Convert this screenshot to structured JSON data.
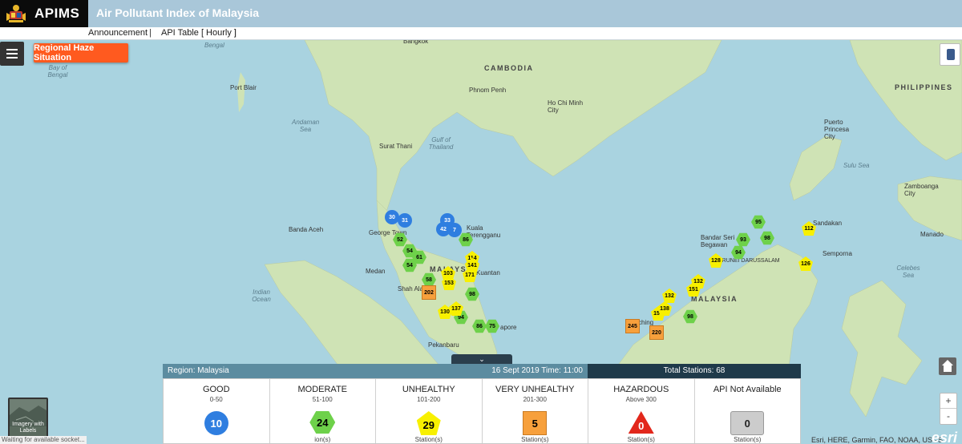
{
  "header": {
    "brand": "APIMS",
    "title": "Air Pollutant Index of Malaysia",
    "nav": [
      {
        "label": "Announcement"
      },
      {
        "label": "API Table [ Hourly ]"
      }
    ]
  },
  "controls": {
    "haze_button": "Regional Haze Situation",
    "basemap_label": "Imagery with Labels",
    "zoom_in": "+",
    "zoom_out": "-",
    "collapse_glyph": "⌄"
  },
  "status_text": "Waiting for available socket...",
  "attribution": "Esri, HERE, Garmin, FAO, NOAA, USGS",
  "esri_logo": "esri",
  "places": {
    "bangkok": "Bangkok",
    "cambodia": "CAMBODIA",
    "phnom_penh": "Phnom Penh",
    "ho_chi_minh": "Ho Chi Minh City",
    "philippines": "PHILIPPINES",
    "port_blair": "Port Blair",
    "surat_thani": "Surat Thani",
    "banda_aceh": "Banda Aceh",
    "george_town": "George Town",
    "kuala_terengganu": "Kuala Terengganu",
    "medan": "Medan",
    "shah_alam": "Shah Alam",
    "kuantan": "Kuantan",
    "pekanbaru": "Pekanbaru",
    "singapore": "apore",
    "malaysia_peninsula": "MALAYSIA",
    "malaysia_borneo": "MALAYSIA",
    "bandar_seri_begawan": "Bandar Seri Begawan",
    "brunei": "BRUNEI DARUSSALAM",
    "sandakan": "Sandakan",
    "semporna": "Semporna",
    "puerto_princesa": "Puerto Princesa City",
    "zamboanga": "Zamboanga City",
    "kuching": "ching",
    "manado": "Manado"
  },
  "seas": {
    "bay_of_bengal": "Bay of Bengal",
    "andaman_sea": "Andaman Sea",
    "gulf_of_thailand": "Gulf of Thailand",
    "indian_ocean": "Indian Ocean",
    "sulu_sea": "Sulu Sea",
    "celebes_sea": "Celebes Sea",
    "bengal_top": "Bengal"
  },
  "colors": {
    "good": "#2f7ee0",
    "moderate": "#6ed14a",
    "unhealthy": "#f8f000",
    "very_unhealthy": "#f7a03c",
    "hazardous": "#e2271b",
    "not_available": "#cccccc"
  },
  "markers": [
    {
      "v": "30",
      "cat": "good",
      "shape": "circle"
    },
    {
      "v": "31",
      "cat": "good",
      "shape": "circle"
    },
    {
      "v": "33",
      "cat": "good",
      "shape": "circle"
    },
    {
      "v": "42",
      "cat": "good",
      "shape": "circle"
    },
    {
      "v": "7",
      "cat": "good",
      "shape": "circle"
    },
    {
      "v": "52",
      "cat": "moderate",
      "shape": "hex"
    },
    {
      "v": "54",
      "cat": "moderate",
      "shape": "hex"
    },
    {
      "v": "61",
      "cat": "moderate",
      "shape": "hex"
    },
    {
      "v": "54",
      "cat": "moderate",
      "shape": "hex"
    },
    {
      "v": "86",
      "cat": "moderate",
      "shape": "hex"
    },
    {
      "v": "58",
      "cat": "moderate",
      "shape": "hex"
    },
    {
      "v": "98",
      "cat": "moderate",
      "shape": "hex"
    },
    {
      "v": "94",
      "cat": "moderate",
      "shape": "hex"
    },
    {
      "v": "86",
      "cat": "moderate",
      "shape": "hex"
    },
    {
      "v": "75",
      "cat": "moderate",
      "shape": "hex"
    },
    {
      "v": "98",
      "cat": "moderate",
      "shape": "hex"
    },
    {
      "v": "95",
      "cat": "moderate",
      "shape": "hex"
    },
    {
      "v": "93",
      "cat": "moderate",
      "shape": "hex"
    },
    {
      "v": "94",
      "cat": "moderate",
      "shape": "hex"
    },
    {
      "v": "98",
      "cat": "moderate",
      "shape": "hex"
    },
    {
      "v": "114",
      "cat": "unhealthy",
      "shape": "pent"
    },
    {
      "v": "141",
      "cat": "unhealthy",
      "shape": "pent"
    },
    {
      "v": "103",
      "cat": "unhealthy",
      "shape": "pent"
    },
    {
      "v": "171",
      "cat": "unhealthy",
      "shape": "pent"
    },
    {
      "v": "153",
      "cat": "unhealthy",
      "shape": "pent"
    },
    {
      "v": "137",
      "cat": "unhealthy",
      "shape": "pent"
    },
    {
      "v": "130",
      "cat": "unhealthy",
      "shape": "pent"
    },
    {
      "v": "132",
      "cat": "unhealthy",
      "shape": "pent"
    },
    {
      "v": "151",
      "cat": "unhealthy",
      "shape": "pent"
    },
    {
      "v": "132",
      "cat": "unhealthy",
      "shape": "pent"
    },
    {
      "v": "157",
      "cat": "unhealthy",
      "shape": "pent"
    },
    {
      "v": "138",
      "cat": "unhealthy",
      "shape": "pent"
    },
    {
      "v": "128",
      "cat": "unhealthy",
      "shape": "pent"
    },
    {
      "v": "112",
      "cat": "unhealthy",
      "shape": "pent"
    },
    {
      "v": "126",
      "cat": "unhealthy",
      "shape": "pent"
    },
    {
      "v": "202",
      "cat": "very_unhealthy",
      "shape": "square"
    },
    {
      "v": "245",
      "cat": "very_unhealthy",
      "shape": "square"
    },
    {
      "v": "220",
      "cat": "very_unhealthy",
      "shape": "square"
    }
  ],
  "panel": {
    "region": "Region: Malaysia",
    "date_time": "16 Sept 2019   Time: 11:00",
    "total": "Total Stations: 68",
    "categories": [
      {
        "name": "GOOD",
        "range": "0-50",
        "count": "10",
        "foot": ""
      },
      {
        "name": "MODERATE",
        "range": "51-100",
        "count": "24",
        "foot": "ion(s)"
      },
      {
        "name": "UNHEALTHY",
        "range": "101-200",
        "count": "29",
        "foot": "Station(s)"
      },
      {
        "name": "VERY UNHEALTHY",
        "range": "201-300",
        "count": "5",
        "foot": "Station(s)"
      },
      {
        "name": "HAZARDOUS",
        "range": "Above 300",
        "count": "0",
        "foot": "Station(s)"
      },
      {
        "name": "API Not Available",
        "range": "",
        "count": "0",
        "foot": "Station(s)"
      }
    ]
  }
}
